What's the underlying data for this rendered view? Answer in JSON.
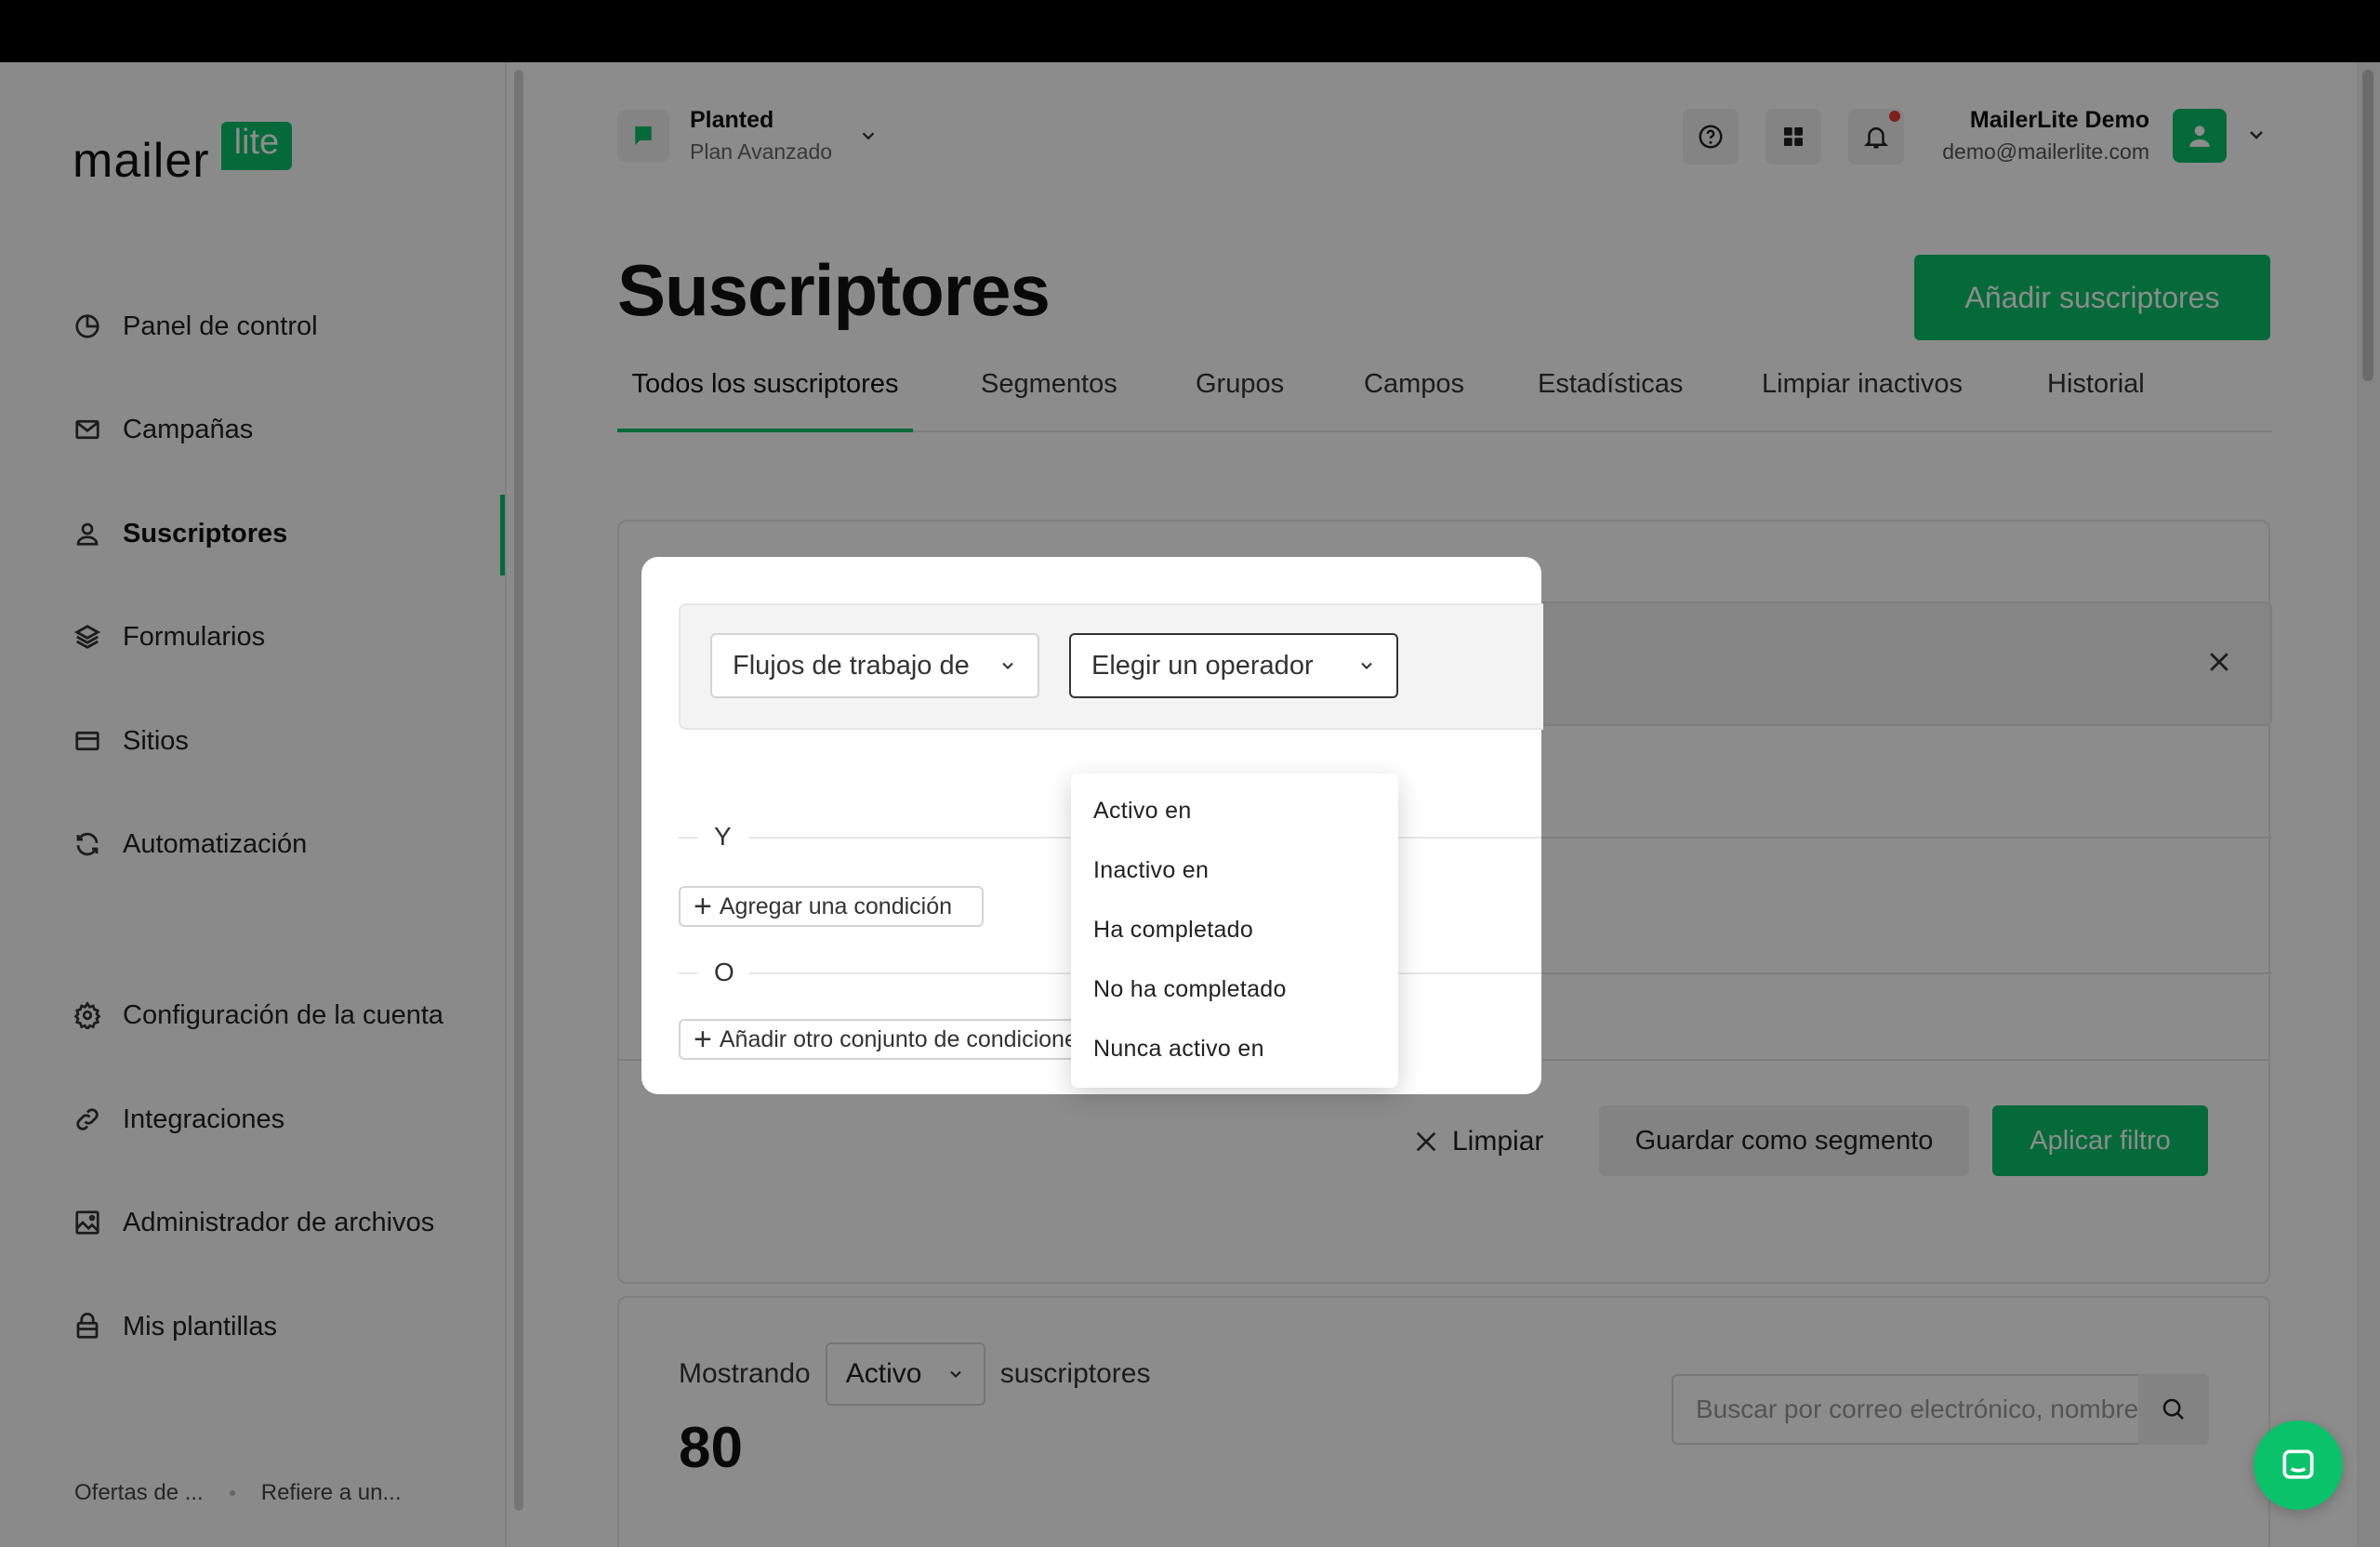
{
  "sidebar": {
    "logo_text": "mailer",
    "logo_badge": "lite",
    "items": [
      {
        "label": "Panel de control",
        "icon": "dashboard-icon"
      },
      {
        "label": "Campañas",
        "icon": "mail-icon"
      },
      {
        "label": "Suscriptores",
        "icon": "user-icon",
        "active": true
      },
      {
        "label": "Formularios",
        "icon": "layers-icon"
      },
      {
        "label": "Sitios",
        "icon": "browser-icon"
      },
      {
        "label": "Automatización",
        "icon": "refresh-icon"
      },
      {
        "label": "Configuración de la cuenta",
        "icon": "gear-icon"
      },
      {
        "label": "Integraciones",
        "icon": "link-icon"
      },
      {
        "label": "Administrador de archivos",
        "icon": "image-icon"
      },
      {
        "label": "Mis plantillas",
        "icon": "template-icon"
      }
    ],
    "footer": [
      "Ofertas de ...",
      "Refiere a un..."
    ]
  },
  "header": {
    "account_name": "Planted",
    "account_plan": "Plan Avanzado",
    "user_name": "MailerLite Demo",
    "user_email": "demo@mailerlite.com"
  },
  "page": {
    "title": "Suscriptores",
    "add_button": "Añadir suscriptores",
    "tabs": [
      "Todos los suscriptores",
      "Segmentos",
      "Grupos",
      "Campos",
      "Estadísticas",
      "Limpiar inactivos",
      "Historial"
    ]
  },
  "filter": {
    "clear_label": "Limpiar",
    "save_label": "Guardar como segmento",
    "apply_label": "Aplicar filtro"
  },
  "list": {
    "showing_label": "Mostrando",
    "status_value": "Activo",
    "subscribers_label": "suscriptores",
    "count": "80",
    "search_placeholder": "Buscar por correo electrónico, nombre"
  },
  "modal": {
    "field_select": "Flujos de trabajo de",
    "operator_select": "Elegir un operador",
    "and_label": "Y",
    "or_label": "O",
    "add_condition": "Agregar una condición",
    "add_set": "Añadir otro conjunto de condiciones",
    "operator_options": [
      "Activo en",
      "Inactivo en",
      "Ha completado",
      "No ha completado",
      "Nunca activo en"
    ]
  },
  "colors": {
    "brand_green": "#09c269"
  }
}
